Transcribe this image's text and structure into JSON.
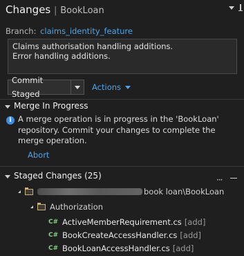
{
  "header": {
    "title": "Changes",
    "separator": "|",
    "repo": "BookLoan"
  },
  "branch": {
    "label": "Branch:",
    "name": "claims_identity_feature"
  },
  "commit_message": {
    "line1": "Claims authorisation handling additions.",
    "line2": "Error handling additions."
  },
  "toolbar": {
    "commit_label": "Commit Staged",
    "actions_label": "Actions"
  },
  "merge": {
    "title": "Merge In Progress",
    "message": "A merge operation is in progress in the 'BookLoan' repository. Commit your changes to complete the merge operation.",
    "abort_label": "Abort"
  },
  "staged": {
    "title": "Staged Changes (25)",
    "repo_path_visible": "book loan\\BookLoan",
    "folder": "Authorization",
    "files": [
      {
        "icon": "C#",
        "name": "ActiveMemberRequirement.cs",
        "status": "[add]"
      },
      {
        "icon": "C#",
        "name": "BookCreateAccessHandler.cs",
        "status": "[add]"
      },
      {
        "icon": "C#",
        "name": "BookLoanAccessHandler.cs",
        "status": "[add]"
      }
    ]
  },
  "colors": {
    "background": "#1f1f1f",
    "link": "#4fa3e8",
    "info": "#3b8ee0",
    "csharp": "#7fd27f"
  }
}
